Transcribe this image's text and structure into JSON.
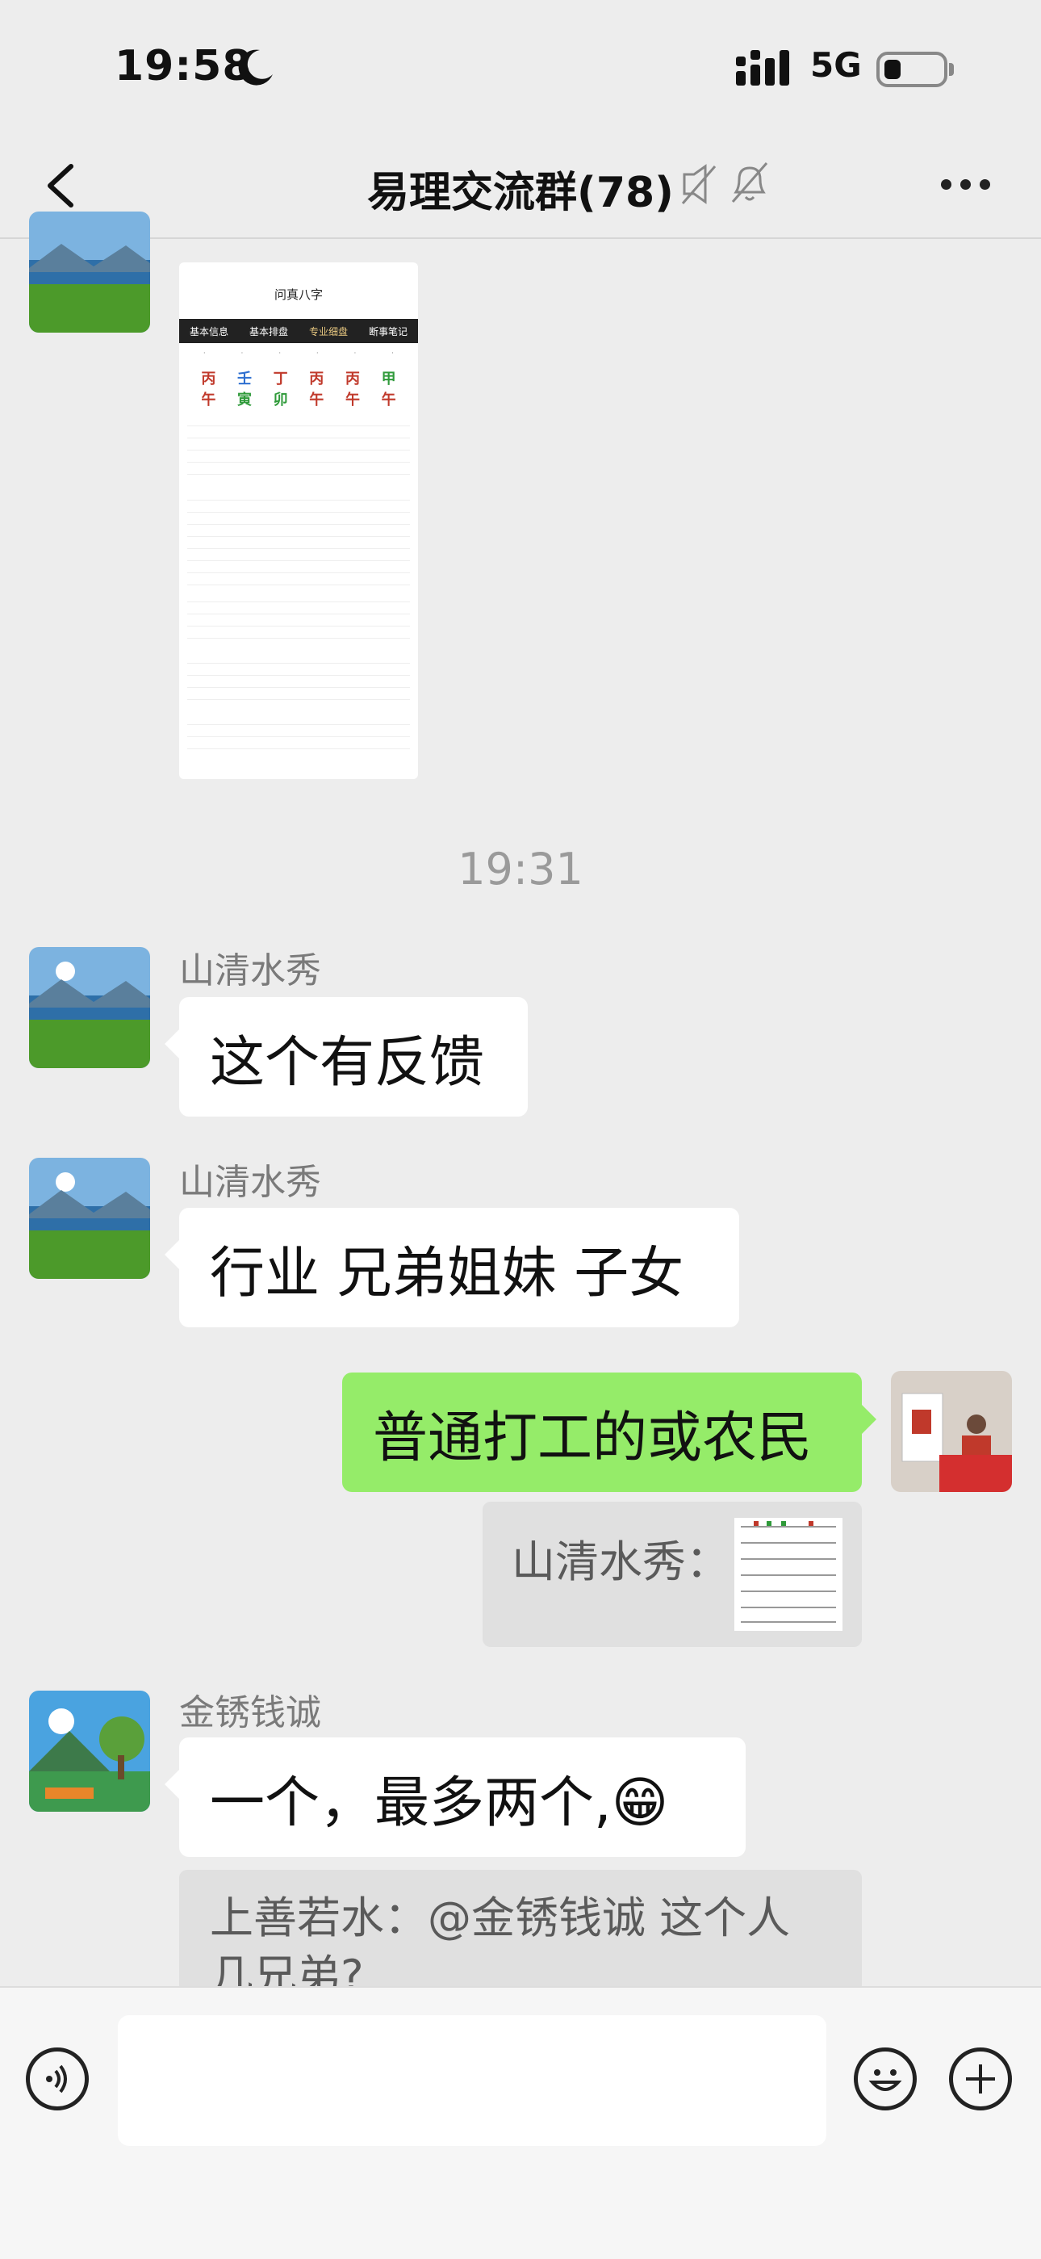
{
  "status_bar": {
    "time": "19:58",
    "network": "5G"
  },
  "header": {
    "back_label": "",
    "title": "易理交流群(78)"
  },
  "messages": {
    "timestamp": "19:31",
    "m1": {
      "sender": "山清水秀",
      "text": "这个有反馈"
    },
    "m2": {
      "sender": "山清水秀",
      "text": "行业 兄弟姐妹 子女"
    },
    "m3": {
      "text": "普通打工的或农民",
      "quote_sender": "山清水秀："
    },
    "m4": {
      "sender": "金锈钱诚",
      "text": "一个，最多两个,😁",
      "quote": "上善若水：@金锈钱诚 这个人几兄弟?"
    }
  },
  "shot": {
    "title": "问真八字",
    "tabs": [
      "基本信息",
      "基本排盘",
      "专业细盘",
      "断事笔记"
    ],
    "stems": [
      "丙",
      "壬",
      "丁",
      "丙",
      "丙",
      "甲"
    ],
    "branches": [
      "午",
      "寅",
      "卯",
      "午",
      "午",
      "午"
    ]
  },
  "colors": {
    "bubble_me": "#95ec69",
    "background": "#ededed"
  },
  "icons": [
    "back-icon",
    "voice-mute-icon",
    "bell-mute-icon",
    "more-icon",
    "voice-input-icon",
    "emoji-icon",
    "plus-icon"
  ]
}
